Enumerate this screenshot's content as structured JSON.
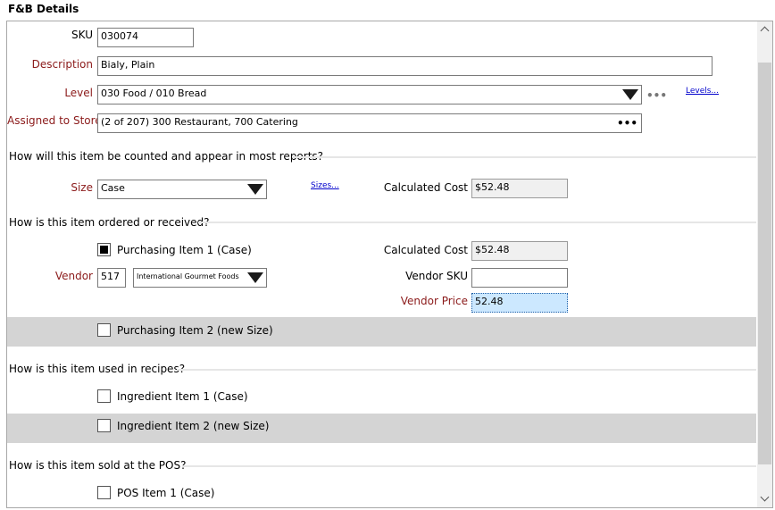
{
  "window_title": "F&B Details",
  "fields": {
    "sku_label": "SKU",
    "sku_value": "030074",
    "description_label": "Description",
    "description_value": "Bialy, Plain",
    "level_label": "Level",
    "level_value": "030 Food / 010 Bread",
    "levels_link": "Levels...",
    "stores_label": "Assigned to Stores",
    "stores_value": "(2 of 207) 300 Restaurant, 700 Catering"
  },
  "sections": {
    "counted": "How will this item be counted and appear in most reports?",
    "ordered": "How is this item ordered or received?",
    "recipes": "How is this item used in recipes?",
    "pos": "How is this item sold at the POS?"
  },
  "size": {
    "label": "Size",
    "value": "Case",
    "sizes_link": "Sizes...",
    "calc_cost_label": "Calculated Cost",
    "calc_cost_value": "$52.48"
  },
  "purchasing": {
    "item1_label": "Purchasing Item 1 (Case)",
    "item1_checked": true,
    "calc_cost_label": "Calculated Cost",
    "calc_cost_value": "$52.48",
    "vendor_label": "Vendor",
    "vendor_code": "517",
    "vendor_name": "International Gourmet Foods",
    "vendor_sku_label": "Vendor SKU",
    "vendor_sku_value": "",
    "vendor_price_label": "Vendor Price",
    "vendor_price_value": "52.48",
    "item2_label": "Purchasing Item 2 (new Size)",
    "item2_checked": false
  },
  "recipes": {
    "ingredient1_label": "Ingredient Item 1 (Case)",
    "ingredient2_label": "Ingredient Item 2 (new Size)"
  },
  "pos": {
    "item1_label": "POS Item 1 (Case)"
  },
  "icons": {
    "more": "ellipsis-icon",
    "dropdown": "triangle-down-icon",
    "scroll_up": "chevron-up-icon",
    "scroll_down": "chevron-down-icon"
  },
  "colors": {
    "required_label": "#8b1a1a",
    "band": "#d4d4d4",
    "link": "#0000cc",
    "selected_input": "#cce8ff"
  }
}
